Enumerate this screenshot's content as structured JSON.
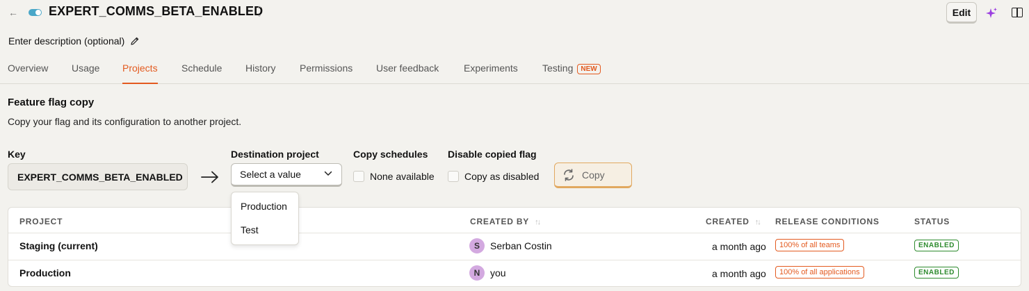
{
  "header": {
    "flag_key": "EXPERT_COMMS_BETA_ENABLED",
    "edit_label": "Edit",
    "description_placeholder": "Enter description (optional)"
  },
  "tabs": [
    {
      "label": "Overview"
    },
    {
      "label": "Usage"
    },
    {
      "label": "Projects",
      "active": true
    },
    {
      "label": "Schedule"
    },
    {
      "label": "History"
    },
    {
      "label": "Permissions"
    },
    {
      "label": "User feedback"
    },
    {
      "label": "Experiments"
    },
    {
      "label": "Testing",
      "badge": "NEW"
    }
  ],
  "copy_section": {
    "title": "Feature flag copy",
    "subtitle": "Copy your flag and its configuration to another project.",
    "key_label": "Key",
    "key_value": "EXPERT_COMMS_BETA_ENABLED",
    "destination_label": "Destination project",
    "destination_placeholder": "Select a value",
    "destination_options": [
      "Production",
      "Test"
    ],
    "schedules_label": "Copy schedules",
    "schedules_option": "None available",
    "disable_label": "Disable copied flag",
    "disable_option": "Copy as disabled",
    "copy_button": "Copy"
  },
  "table": {
    "columns": [
      "PROJECT",
      "CREATED BY",
      "CREATED",
      "RELEASE CONDITIONS",
      "STATUS"
    ],
    "rows": [
      {
        "project": "Staging (current)",
        "avatar": "S",
        "created_by": "Serban Costin",
        "created": "a month ago",
        "release": "100% of all teams",
        "status": "ENABLED"
      },
      {
        "project": "Production",
        "avatar": "N",
        "created_by": "you",
        "created": "a month ago",
        "release": "100% of all applications",
        "status": "ENABLED"
      }
    ]
  },
  "colors": {
    "accent": "#e35a1f",
    "enabled": "#2d8a2d",
    "avatar": "#d3a9e0",
    "toggle": "#4aa7c8"
  }
}
